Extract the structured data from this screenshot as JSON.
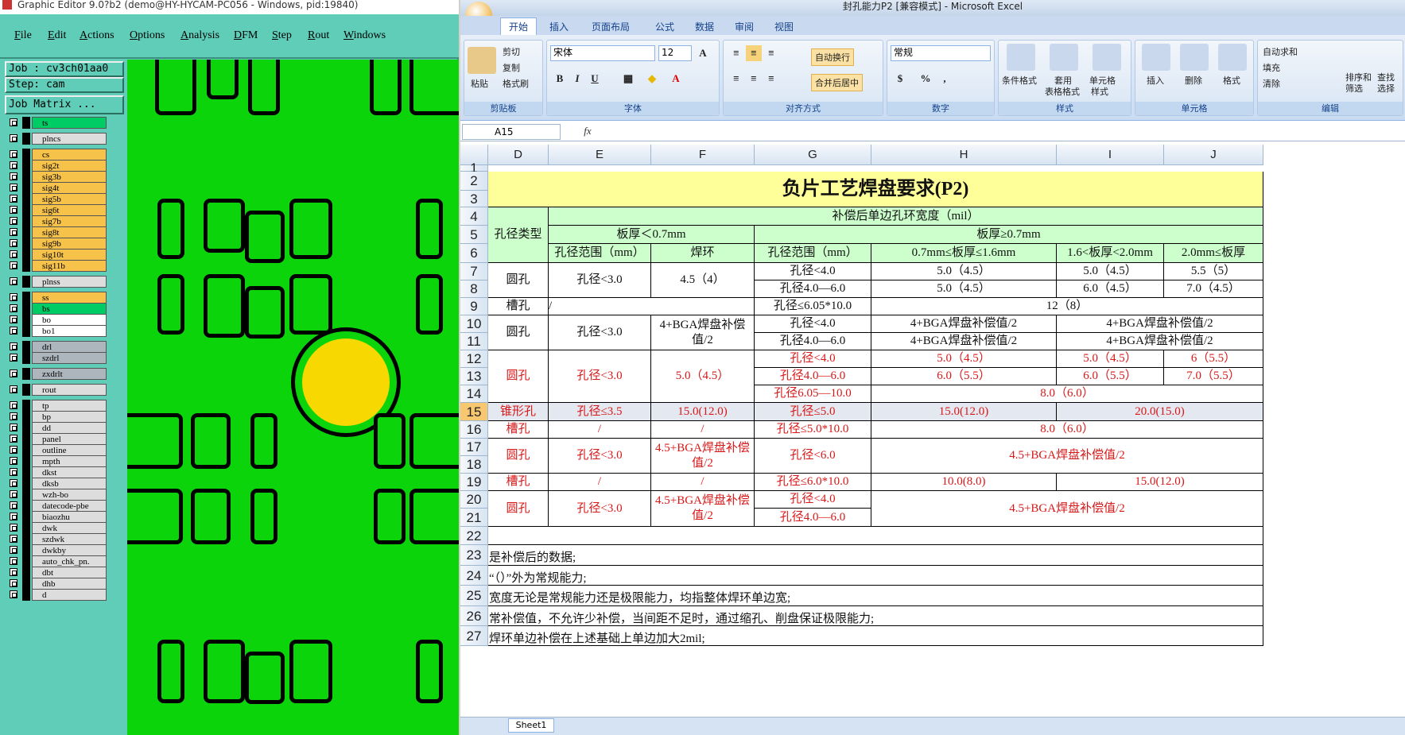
{
  "graphic_editor": {
    "title": "Graphic Editor 9.0?b2 (demo@HY-HYCAM-PC056 - Windows, pid:19840)",
    "menu": [
      "File",
      "Edit",
      "Actions",
      "Options",
      "Analysis",
      "DFM",
      "Step",
      "Rout",
      "Windows"
    ],
    "job_label": "Job : cv3ch01aa0",
    "step_label": "Step: cam",
    "matrix_button": "Job Matrix ...",
    "layers": [
      {
        "name": "ts",
        "color": "#00cc66"
      },
      {
        "name": "plncs",
        "color": "#dddddd"
      },
      {
        "name": "cs",
        "color": "#f6c24a"
      },
      {
        "name": "sig2t",
        "color": "#f6c24a"
      },
      {
        "name": "sig3b",
        "color": "#f6c24a"
      },
      {
        "name": "sig4t",
        "color": "#f6c24a"
      },
      {
        "name": "sig5b",
        "color": "#f6c24a"
      },
      {
        "name": "sig6t",
        "color": "#f6c24a"
      },
      {
        "name": "sig7b",
        "color": "#f6c24a"
      },
      {
        "name": "sig8t",
        "color": "#f6c24a"
      },
      {
        "name": "sig9b",
        "color": "#f6c24a"
      },
      {
        "name": "sig10t",
        "color": "#f6c24a"
      },
      {
        "name": "sig11b",
        "color": "#f6c24a"
      },
      {
        "name": "plnss",
        "color": "#dddddd"
      },
      {
        "name": "ss",
        "color": "#f6c24a"
      },
      {
        "name": "bs",
        "color": "#00cc66"
      },
      {
        "name": "bo",
        "color": "#ffffff"
      },
      {
        "name": "bo1",
        "color": "#ffffff"
      },
      {
        "name": "drl",
        "color": "#aeb6bd"
      },
      {
        "name": "szdrl",
        "color": "#aeb6bd"
      },
      {
        "name": "zxdrlt",
        "color": "#aeb6bd"
      },
      {
        "name": "rout",
        "color": "#dddddd"
      },
      {
        "name": "tp",
        "color": "#dddddd"
      },
      {
        "name": "bp",
        "color": "#dddddd"
      },
      {
        "name": "dd",
        "color": "#dddddd"
      },
      {
        "name": "panel",
        "color": "#dddddd"
      },
      {
        "name": "outline",
        "color": "#dddddd"
      },
      {
        "name": "mpth",
        "color": "#dddddd"
      },
      {
        "name": "dkst",
        "color": "#dddddd"
      },
      {
        "name": "dksb",
        "color": "#dddddd"
      },
      {
        "name": "wzh-bo",
        "color": "#dddddd"
      },
      {
        "name": "datecode-pbe",
        "color": "#dddddd"
      },
      {
        "name": "biaozhu",
        "color": "#dddddd"
      },
      {
        "name": "dwk",
        "color": "#dddddd"
      },
      {
        "name": "szdwk",
        "color": "#dddddd"
      },
      {
        "name": "dwkby",
        "color": "#dddddd"
      },
      {
        "name": "auto_chk_pn.",
        "color": "#dddddd"
      },
      {
        "name": "dbt",
        "color": "#dddddd"
      },
      {
        "name": "dhb",
        "color": "#dddddd"
      },
      {
        "name": "d",
        "color": "#dddddd"
      }
    ],
    "canvas_colors": {
      "board": "#0bd40b",
      "via": "#f7d800",
      "outline": "#000000"
    }
  },
  "excel": {
    "title": "封孔能力P2 [兼容模式] - Microsoft Excel",
    "tabs": [
      "开始",
      "插入",
      "页面布局",
      "公式",
      "数据",
      "审阅",
      "视图"
    ],
    "ribbon": {
      "clipboard": {
        "paste": "粘贴",
        "cut": "剪切",
        "copy": "复制",
        "format_painter": "格式刷",
        "label": "剪贴板"
      },
      "font": {
        "name": "宋体",
        "size": "12",
        "label": "字体"
      },
      "align": {
        "wrap": "自动换行",
        "merge": "合并后居中",
        "label": "对齐方式"
      },
      "number": {
        "format": "常规",
        "label": "数字"
      },
      "styles": {
        "cond": "条件格式",
        "table1": "套用",
        "table2": "表格格式",
        "cell1": "单元格",
        "cell2": "样式",
        "label": "样式"
      },
      "cells": {
        "insert": "插入",
        "delete": "删除",
        "format": "格式",
        "label": "单元格"
      },
      "edit": {
        "autosum": "自动求和",
        "fill": "填充",
        "clear": "清除",
        "sort1": "排序和",
        "sort2": "筛选",
        "find1": "查找",
        "find2": "选择",
        "label": "编辑"
      }
    },
    "name_box": "A15",
    "columns": [
      "D",
      "E",
      "F",
      "G",
      "H",
      "I",
      "J"
    ],
    "rows": [
      "1",
      "2",
      "3",
      "4",
      "5",
      "6",
      "7",
      "8",
      "9",
      "10",
      "11",
      "12",
      "13",
      "14",
      "15",
      "16",
      "17",
      "18",
      "19",
      "20",
      "21",
      "22",
      "23",
      "24",
      "25",
      "26",
      "27"
    ],
    "table": {
      "title": "负片工艺焊盘要求(P2)",
      "h_type": "孔径类型",
      "h_top": "补偿后单边孔环宽度（mil）",
      "h_thin": "板厚＜0.7mm",
      "h_thick": "板厚≥0.7mm",
      "h_range1": "孔径范围（mm）",
      "h_ring": "焊环",
      "h_range2": "孔径范围（mm）",
      "h_c1": "0.7mm≤板厚≤1.6mm",
      "h_c2": "1.6<板厚<2.0mm",
      "h_c3": "2.0mm≤板厚",
      "r7_type": "圆孔",
      "r7_range": "孔径<3.0",
      "r7_ring": "4.5（4）",
      "r7_g": "孔径<4.0",
      "r7_h": "5.0（4.5）",
      "r7_i": "5.0（4.5）",
      "r7_j": "5.5（5）",
      "r8_g": "孔径4.0—6.0",
      "r8_h": "5.0（4.5）",
      "r8_i": "6.0（4.5）",
      "r8_j": "7.0（4.5）",
      "r9_type": "槽孔",
      "r9_e": "/",
      "r9_g": "孔径≤6.05*10.0",
      "r9_hj": "12（8）",
      "r10_type": "圆孔",
      "r10_range": "孔径<3.0",
      "r10_ring": "4+BGA焊盘补偿值/2",
      "r10_g": "孔径<4.0",
      "r10_h": "4+BGA焊盘补偿值/2",
      "r10_ij": "4+BGA焊盘补偿值/2",
      "r11_g": "孔径4.0—6.0",
      "r11_h": "4+BGA焊盘补偿值/2",
      "r11_ij": "4+BGA焊盘补偿值/2",
      "r12_type": "圆孔",
      "r12_range": "孔径<3.0",
      "r12_ring": "5.0（4.5）",
      "r12_g": "孔径<4.0",
      "r12_h": "5.0（4.5）",
      "r12_i": "5.0（4.5）",
      "r12_j": "6（5.5）",
      "r13_g": "孔径4.0—6.0",
      "r13_h": "6.0（5.5）",
      "r13_i": "6.0（5.5）",
      "r13_j": "7.0（5.5）",
      "r14_g": "孔径6.05—10.0",
      "r14_hj": "8.0（6.0）",
      "r15_type": "锥形孔",
      "r15_range": "孔径≤3.5",
      "r15_ring": "15.0(12.0)",
      "r15_g": "孔径≤5.0",
      "r15_h": "15.0(12.0)",
      "r15_ij": "20.0(15.0)",
      "r16_type": "槽孔",
      "r16_e": "/",
      "r16_f": "/",
      "r16_g": "孔径≤5.0*10.0",
      "r16_hj": "8.0（6.0）",
      "r17_type": "圆孔",
      "r17_range": "孔径<3.0",
      "r17_ring": "4.5+BGA焊盘补偿值/2",
      "r17_g": "孔径<6.0",
      "r17_hj": "4.5+BGA焊盘补偿值/2",
      "r19_type": "槽孔",
      "r19_e": "/",
      "r19_f": "/",
      "r19_g": "孔径≤6.0*10.0",
      "r19_h": "10.0(8.0)",
      "r19_ij": "15.0(12.0)",
      "r20_type": "圆孔",
      "r20_range": "孔径<3.0",
      "r20_ring": "4.5+BGA焊盘补偿值/2",
      "r20_g": "孔径<4.0",
      "r21_g": "孔径4.0—6.0",
      "r20_hj": "4.5+BGA焊盘补偿值/2"
    },
    "notes": [
      "是补偿后的数据;",
      "“（）”外为常规能力;",
      "宽度无论是常规能力还是极限能力，均指整体焊环单边宽;",
      "常补偿值，不允许少补偿，当间距不足时，通过缩孔、削盘保证极限能力;",
      "焊环单边补偿在上述基础上单边加大2mil;"
    ],
    "sheet_tab": "Sheet1"
  }
}
